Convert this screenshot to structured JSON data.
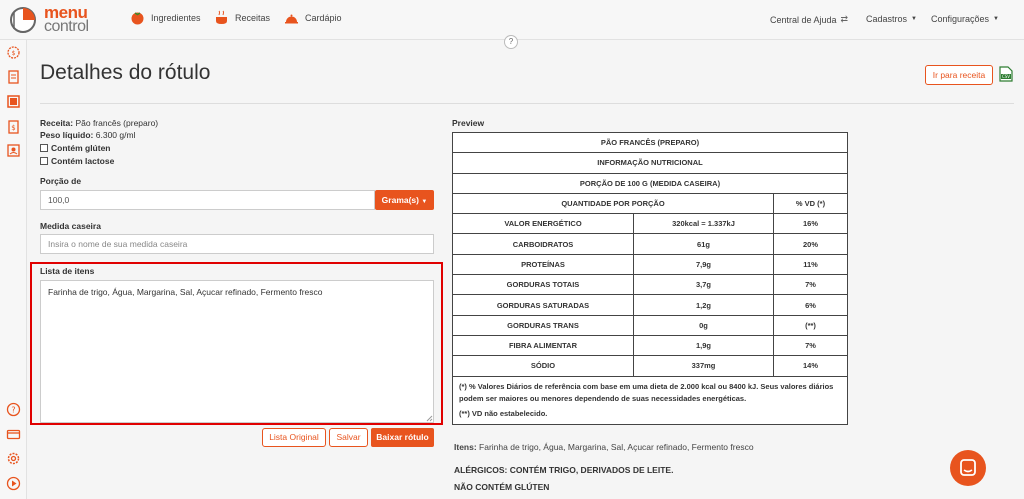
{
  "brand": {
    "line1": "menu",
    "line2": "control"
  },
  "nav": {
    "items": [
      {
        "label": "Ingredientes",
        "icon": "tomato-icon"
      },
      {
        "label": "Receitas",
        "icon": "pot-icon"
      },
      {
        "label": "Cardápio",
        "icon": "cloche-icon"
      }
    ],
    "right": [
      {
        "label": "Central de Ajuda",
        "icon": "chevron-swap-icon"
      },
      {
        "label": "Cadastros",
        "icon": "caret-down-icon"
      },
      {
        "label": "Configurações",
        "icon": "caret-down-icon"
      }
    ]
  },
  "help_glyph": "?",
  "page": {
    "title": "Detalhes do rótulo",
    "goto_recipe": "Ir para receita",
    "export_icon": "csv-file-icon"
  },
  "recipe": {
    "receita_label": "Receita:",
    "receita_value": "Pão francês (preparo)",
    "peso_label": "Peso líquido:",
    "peso_value": "6.300 g/ml",
    "gluten": "Contém glúten",
    "lactose": "Contém lactose"
  },
  "portion": {
    "label": "Porção de",
    "value": "100,0",
    "unit_button": "Grama(s)"
  },
  "household": {
    "label": "Medida caseira",
    "placeholder": "Insira o nome de sua medida caseira"
  },
  "items_list": {
    "label": "Lista de itens",
    "value": "Farinha de trigo, Água, Margarina, Sal, Açucar refinado, Fermento fresco"
  },
  "actions": {
    "original": "Lista Original",
    "save": "Salvar",
    "download": "Baixar rótulo"
  },
  "preview": {
    "label": "Preview",
    "product": "PÃO FRANCÊS (PREPARO)",
    "info": "INFORMAÇÃO NUTRICIONAL",
    "portion": "PORÇÃO DE 100 G (MEDIDA CASEIRA)",
    "col_qty": "QUANTIDADE POR PORÇÃO",
    "col_vd": "% VD (*)",
    "rows": [
      {
        "name": "VALOR ENERGÉTICO",
        "qty": "320kcal = 1.337kJ",
        "vd": "16%"
      },
      {
        "name": "CARBOIDRATOS",
        "qty": "61g",
        "vd": "20%"
      },
      {
        "name": "PROTEÍNAS",
        "qty": "7,9g",
        "vd": "11%"
      },
      {
        "name": "GORDURAS TOTAIS",
        "qty": "3,7g",
        "vd": "7%"
      },
      {
        "name": "GORDURAS SATURADAS",
        "qty": "1,2g",
        "vd": "6%"
      },
      {
        "name": "GORDURAS TRANS",
        "qty": "0g",
        "vd": "(**)"
      },
      {
        "name": "FIBRA ALIMENTAR",
        "qty": "1,9g",
        "vd": "7%"
      },
      {
        "name": "SÓDIO",
        "qty": "337mg",
        "vd": "14%"
      }
    ],
    "footnote1": "(*) % Valores Diários de referência com base em uma dieta de 2.000 kcal ou 8400 kJ. Seus valores diários podem ser maiores ou menores dependendo de suas necessidades energéticas.",
    "footnote2": "(**) VD não estabelecido.",
    "itens_label": "Itens:",
    "itens_value": "Farinha de trigo, Água, Margarina, Sal, Açucar refinado, Fermento fresco",
    "allergens": "ALÉRGICOS: CONTÉM TRIGO, DERIVADOS DE LEITE.",
    "gluten": "NÃO CONTÉM GLÚTEN"
  },
  "colors": {
    "accent": "#e8541e",
    "highlight": "#e00000"
  }
}
